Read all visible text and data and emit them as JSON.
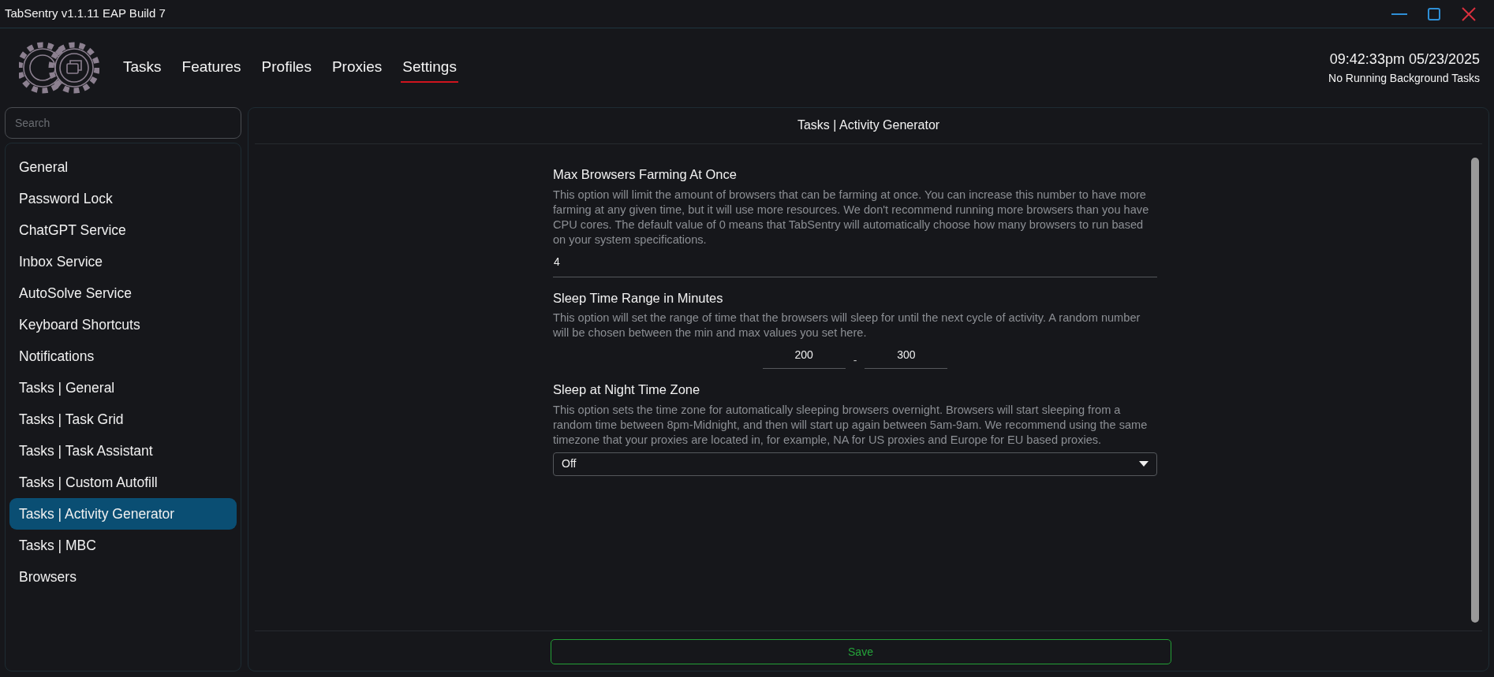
{
  "window": {
    "title": "TabSentry v1.1.11 EAP Build 7"
  },
  "nav": [
    {
      "label": "Tasks",
      "selected": false
    },
    {
      "label": "Features",
      "selected": false
    },
    {
      "label": "Profiles",
      "selected": false
    },
    {
      "label": "Proxies",
      "selected": false
    },
    {
      "label": "Settings",
      "selected": true
    }
  ],
  "clock": {
    "time": "09:42:33pm 05/23/2025",
    "status": "No Running Background Tasks"
  },
  "search": {
    "placeholder": "Search"
  },
  "sidebar": {
    "items": [
      {
        "label": "General",
        "selected": false
      },
      {
        "label": "Password Lock",
        "selected": false
      },
      {
        "label": "ChatGPT Service",
        "selected": false
      },
      {
        "label": "Inbox Service",
        "selected": false
      },
      {
        "label": "AutoSolve Service",
        "selected": false
      },
      {
        "label": "Keyboard Shortcuts",
        "selected": false
      },
      {
        "label": "Notifications",
        "selected": false
      },
      {
        "label": "Tasks | General",
        "selected": false
      },
      {
        "label": "Tasks | Task Grid",
        "selected": false
      },
      {
        "label": "Tasks | Task Assistant",
        "selected": false
      },
      {
        "label": "Tasks | Custom Autofill",
        "selected": false
      },
      {
        "label": "Tasks | Activity Generator",
        "selected": true
      },
      {
        "label": "Tasks | MBC",
        "selected": false
      },
      {
        "label": "Browsers",
        "selected": false
      }
    ]
  },
  "panel": {
    "title": "Tasks | Activity Generator",
    "settings": [
      {
        "kind": "number",
        "title": "Max Browsers Farming At Once",
        "description": "This option will limit the amount of browsers that can be farming at once. You can increase this number to have more farming at any given time, but it will use more resources. We don't recommend running more browsers than you have CPU cores. The default value of 0 means that TabSentry will automatically choose how many browsers to run based on your system specifications.",
        "value": "4"
      },
      {
        "kind": "range",
        "title": "Sleep Time Range in Minutes",
        "description": "This option will set the range of time that the browsers will sleep for until the next cycle of activity. A random number will be chosen between the min and max values you set here.",
        "min": "200",
        "separator": "-",
        "max": "300"
      },
      {
        "kind": "select",
        "title": "Sleep at Night Time Zone",
        "description": "This option sets the time zone for automatically sleeping browsers overnight. Browsers will start sleeping from a random time between 8pm-Midnight, and then will start up again between 5am-9am. We recommend using the same timezone that your proxies are located in, for example, NA for US proxies and Europe for EU based proxies.",
        "value": "Off"
      }
    ],
    "save_button": "Save"
  }
}
